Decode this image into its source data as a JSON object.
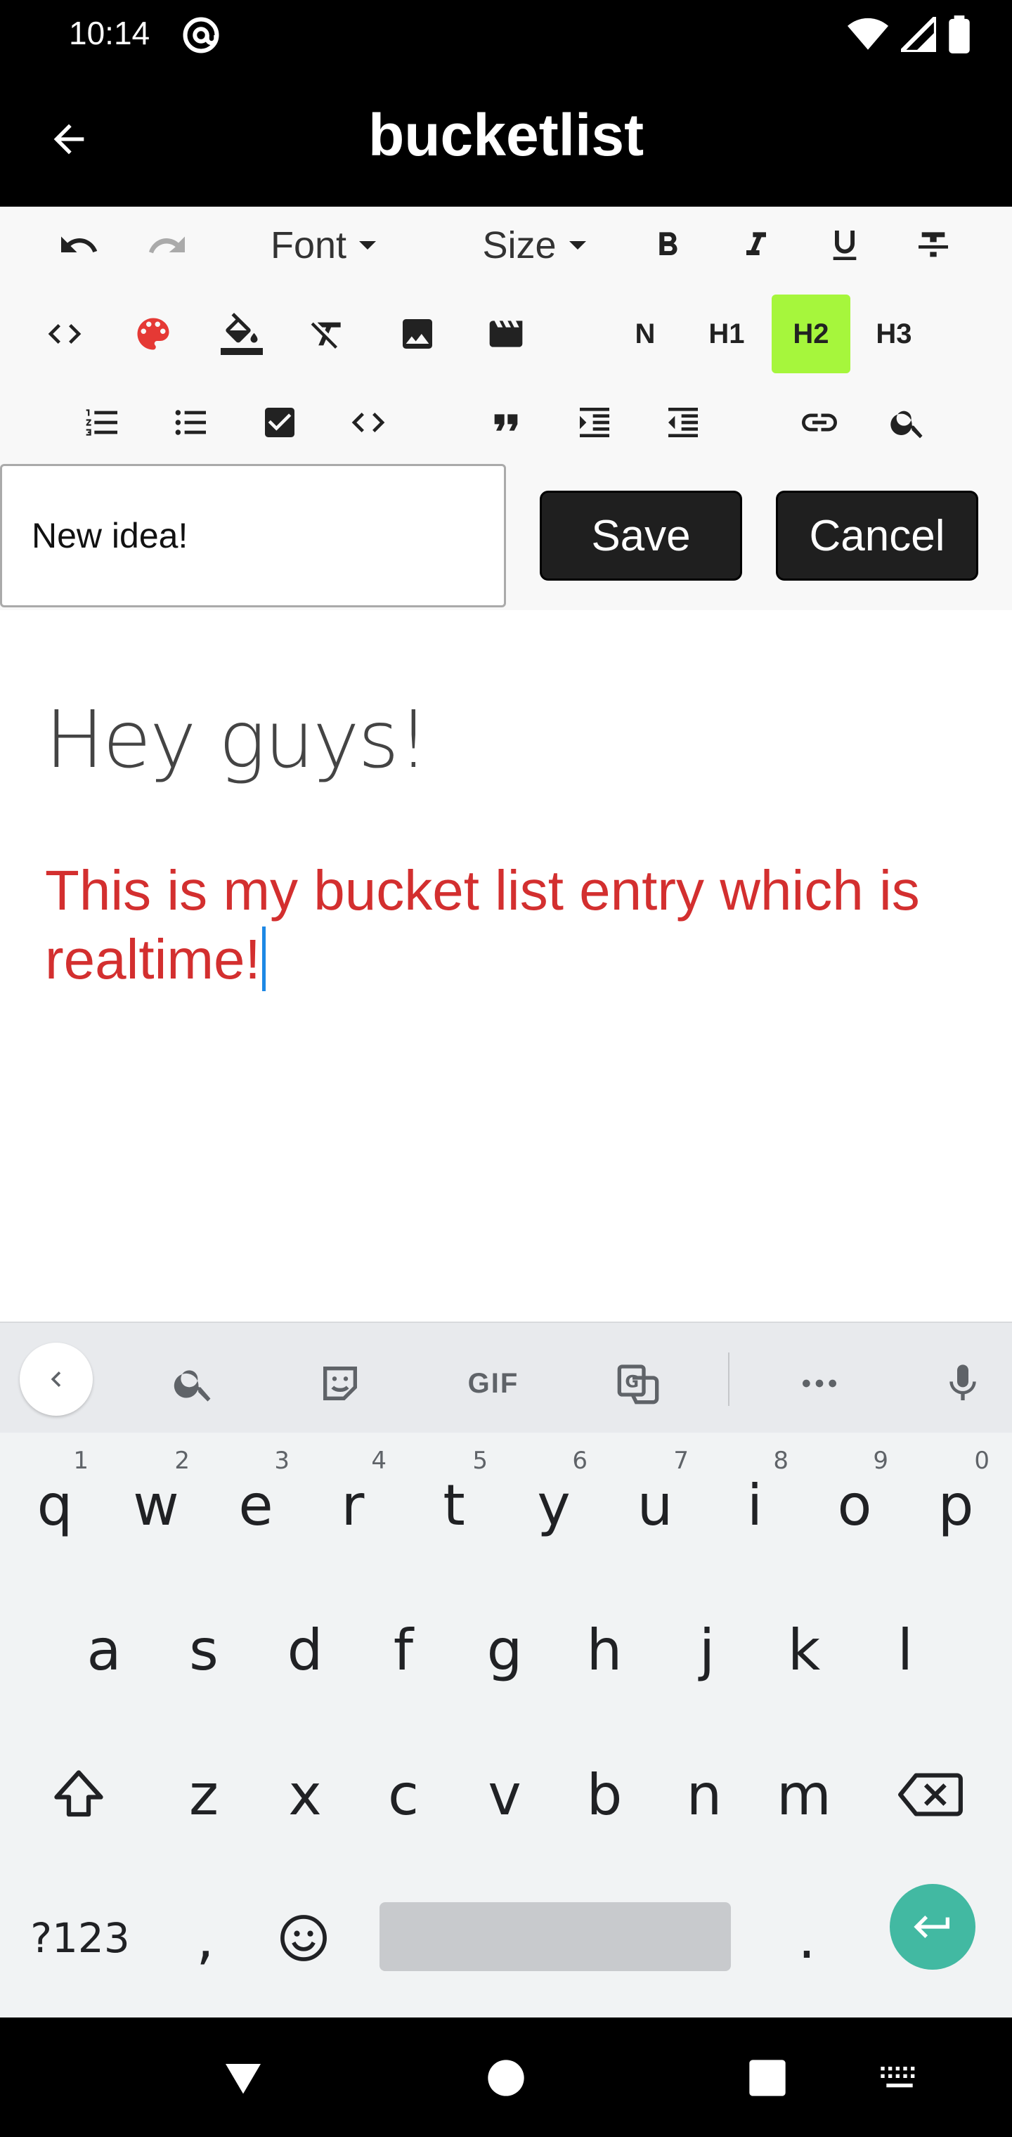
{
  "status_bar": {
    "time": "10:14",
    "icons": [
      "at-sign-icon",
      "wifi-icon",
      "signal-icon",
      "battery-icon"
    ]
  },
  "app_bar": {
    "title": "bucketlist",
    "back_icon": "arrow-back-icon"
  },
  "toolbar": {
    "font_label": "Font",
    "size_label": "Size",
    "headings": [
      "N",
      "H1",
      "H2",
      "H3"
    ],
    "active_heading": "H2",
    "active_color": "#a6f63c"
  },
  "form": {
    "title_value": "New idea!",
    "save_label": "Save",
    "cancel_label": "Cancel"
  },
  "editor": {
    "heading": "Hey guys!",
    "body": "This is my bucket list entry which is realtime!",
    "body_color": "#d32f2f"
  },
  "keyboard": {
    "suggestion_bar": {
      "gif_label": "GIF"
    },
    "row1": [
      {
        "k": "q",
        "n": "1"
      },
      {
        "k": "w",
        "n": "2"
      },
      {
        "k": "e",
        "n": "3"
      },
      {
        "k": "r",
        "n": "4"
      },
      {
        "k": "t",
        "n": "5"
      },
      {
        "k": "y",
        "n": "6"
      },
      {
        "k": "u",
        "n": "7"
      },
      {
        "k": "i",
        "n": "8"
      },
      {
        "k": "o",
        "n": "9"
      },
      {
        "k": "p",
        "n": "0"
      }
    ],
    "row2": [
      "a",
      "s",
      "d",
      "f",
      "g",
      "h",
      "j",
      "k",
      "l"
    ],
    "row3": [
      "z",
      "x",
      "c",
      "v",
      "b",
      "n",
      "m"
    ],
    "symbols_label": "?123",
    "comma_label": ",",
    "period_label": ".",
    "enter_color": "#42b9a2"
  }
}
